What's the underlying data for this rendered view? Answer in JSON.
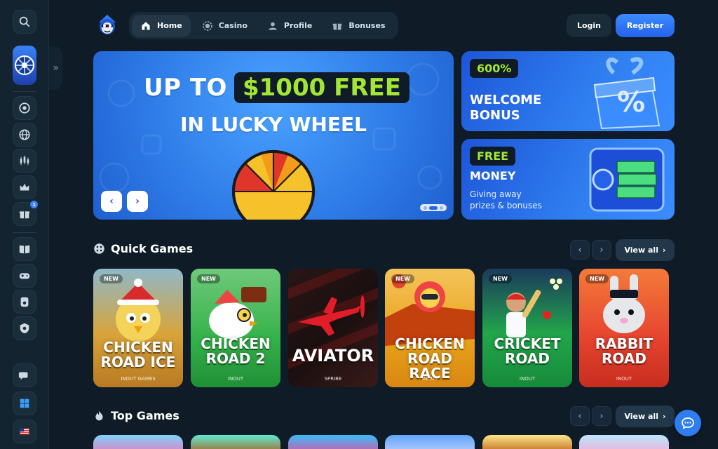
{
  "nav": {
    "items": [
      {
        "label": "Home",
        "icon": "home-icon",
        "active": true
      },
      {
        "label": "Casino",
        "icon": "casino-chip-icon",
        "active": false
      },
      {
        "label": "Profile",
        "icon": "user-icon",
        "active": false
      },
      {
        "label": "Bonuses",
        "icon": "gift-icon",
        "active": false
      }
    ]
  },
  "auth": {
    "login": "Login",
    "register": "Register"
  },
  "hero": {
    "line1_prefix": "UP TO",
    "line1_amount": "$1000 FREE",
    "line2": "IN LUCKY WHEEL",
    "prev": "‹",
    "next": "›"
  },
  "promos": [
    {
      "pill": "600%",
      "title_1": "WELCOME",
      "title_2": "BONUS"
    },
    {
      "pill": "FREE",
      "title_1": "MONEY",
      "sub_1": "Giving away",
      "sub_2": "prizes & bonuses"
    }
  ],
  "quick_games": {
    "title": "Quick Games",
    "view_all": "View all",
    "cards": [
      {
        "title_1": "CHICKEN",
        "title_2": "ROAD ICE",
        "provider": "INOUT GAMES",
        "badge": "NEW",
        "bg": "#c99333"
      },
      {
        "title_1": "CHICKEN",
        "title_2": "ROAD 2",
        "provider": "INOUT",
        "badge": "NEW",
        "bg": "#34b24a"
      },
      {
        "title_1": "AVIATOR",
        "title_2": "",
        "provider": "SPRIBE",
        "badge": "",
        "bg": "#1a1414"
      },
      {
        "title_1": "CHICKEN",
        "title_2": "ROAD RACE",
        "provider": "INOUT",
        "badge": "NEW",
        "bg": "#e8a21a"
      },
      {
        "title_1": "CRICKET",
        "title_2": "ROAD",
        "provider": "INOUT",
        "badge": "NEW",
        "bg": "#22a64a"
      },
      {
        "title_1": "RABBIT",
        "title_2": "ROAD",
        "provider": "INOUT",
        "badge": "NEW",
        "bg": "#e5432f"
      }
    ]
  },
  "top_games": {
    "title": "Top Games",
    "view_all": "View all"
  },
  "colors": {
    "accent": "#2f7df0",
    "lime": "#a3e635",
    "bg": "#0f1c27"
  }
}
